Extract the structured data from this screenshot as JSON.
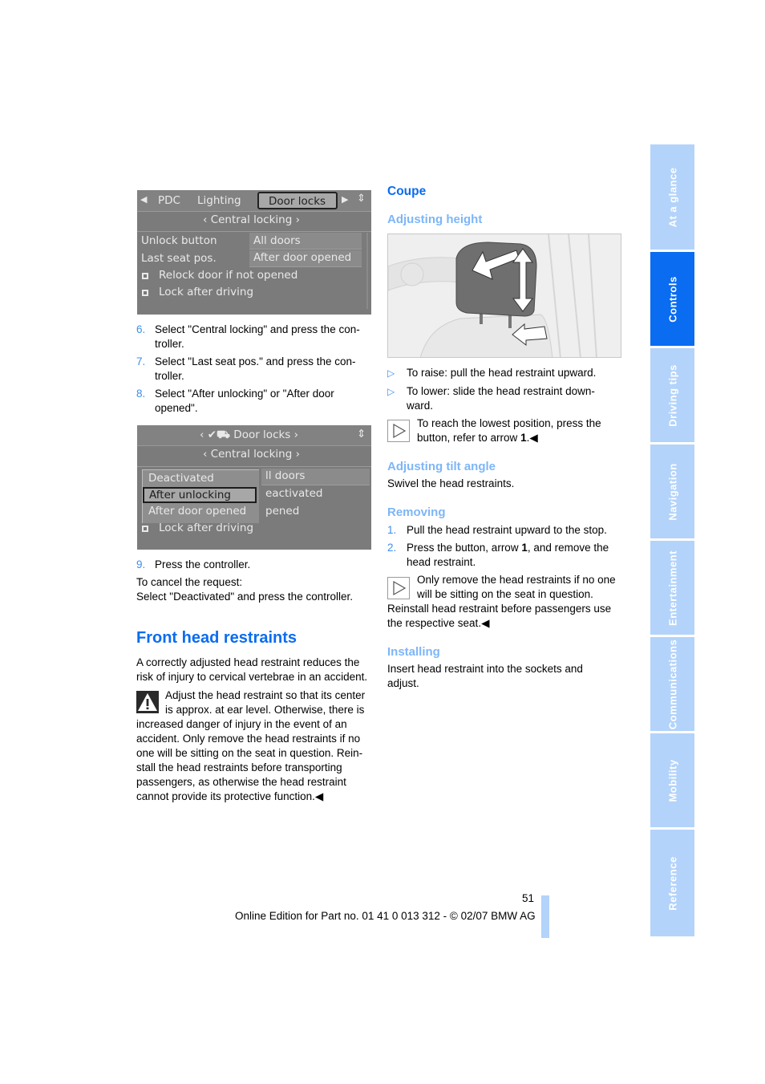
{
  "screen1": {
    "tabs": [
      "PDC",
      "Lighting",
      "Door locks"
    ],
    "active_tab": "Door locks",
    "submenu": "Central locking",
    "rows": [
      {
        "label": "Unlock button",
        "value": "All doors"
      },
      {
        "label": "Last seat pos.",
        "value": "After door opened"
      }
    ],
    "checkboxes": [
      "Relock door if not opened",
      "Lock after driving"
    ]
  },
  "steps_a": [
    {
      "num": "6.",
      "text": "Select \"Central locking\" and press the con-",
      "cont": "troller."
    },
    {
      "num": "7.",
      "text": "Select \"Last seat pos.\" and press the con-",
      "cont": "troller."
    },
    {
      "num": "8.",
      "text": "Select \"After unlocking\" or \"After door",
      "cont": "opened\"."
    }
  ],
  "screen2": {
    "title": "Door locks",
    "submenu": "Central locking",
    "options": [
      "Deactivated",
      "After unlocking",
      "After door opened"
    ],
    "selected_option": "After unlocking",
    "behind_values": [
      "ll doors",
      "eactivated",
      "pened"
    ],
    "checkbox": "Lock after driving"
  },
  "step9": {
    "num": "9.",
    "text": "Press the controller."
  },
  "cancel": {
    "line1": "To cancel the request:",
    "line2": "Select \"Deactivated\" and press the controller."
  },
  "front": {
    "heading": "Front head restraints",
    "intro": [
      "A correctly adjusted head restraint reduces the",
      "risk of injury to cervical vertebrae in an accident."
    ],
    "warning": [
      "Adjust the head restraint so that its center",
      "is approx. at ear level. Otherwise, there is",
      "increased danger of injury in the event of an",
      "accident. Only remove the head restraints if no",
      "one will be sitting on the seat in question. Rein-",
      "stall the head restraints before transporting",
      "passengers, as otherwise the head restraint",
      "cannot provide its protective function.◀"
    ]
  },
  "coupe": {
    "heading": "Coupe",
    "adjusting_height": {
      "heading": "Adjusting height",
      "bullets": [
        {
          "text": "To raise: pull the head restraint upward."
        },
        {
          "text": "To lower: slide the head restraint down-",
          "cont": "ward."
        }
      ],
      "note": [
        "To reach the lowest position, press the",
        "button, refer to arrow "
      ],
      "note_bold": "1",
      "note_end": ".◀"
    },
    "tilt": {
      "heading": "Adjusting tilt angle",
      "text": "Swivel the head restraints."
    },
    "removing": {
      "heading": "Removing",
      "steps": [
        {
          "num": "1.",
          "text": "Pull the head restraint upward to the stop."
        },
        {
          "num": "2.",
          "pre": "Press the button, arrow ",
          "bold": "1",
          "post": ", and remove the",
          "cont": "head restraint."
        }
      ],
      "note": [
        "Only remove the head restraints if no one",
        "will be sitting on the seat in question.",
        "Reinstall head restraint before passengers use",
        "the respective seat.◀"
      ]
    },
    "installing": {
      "heading": "Installing",
      "text": [
        "Insert head restraint into the sockets and",
        "adjust."
      ]
    }
  },
  "footer": {
    "page_number": "51",
    "edition": "Online Edition for Part no. 01 41 0 013 312 - © 02/07 BMW AG"
  },
  "nav": {
    "tabs": [
      "At a glance",
      "Controls",
      "Driving tips",
      "Navigation",
      "Entertainment",
      "Communications",
      "Mobility",
      "Reference"
    ],
    "active": "Controls"
  },
  "colors": {
    "accent": "#0a6cf0",
    "accent_light": "#7db6f7",
    "nav_bg": "#b3d3fa",
    "number_blue": "#3d8ef0"
  }
}
